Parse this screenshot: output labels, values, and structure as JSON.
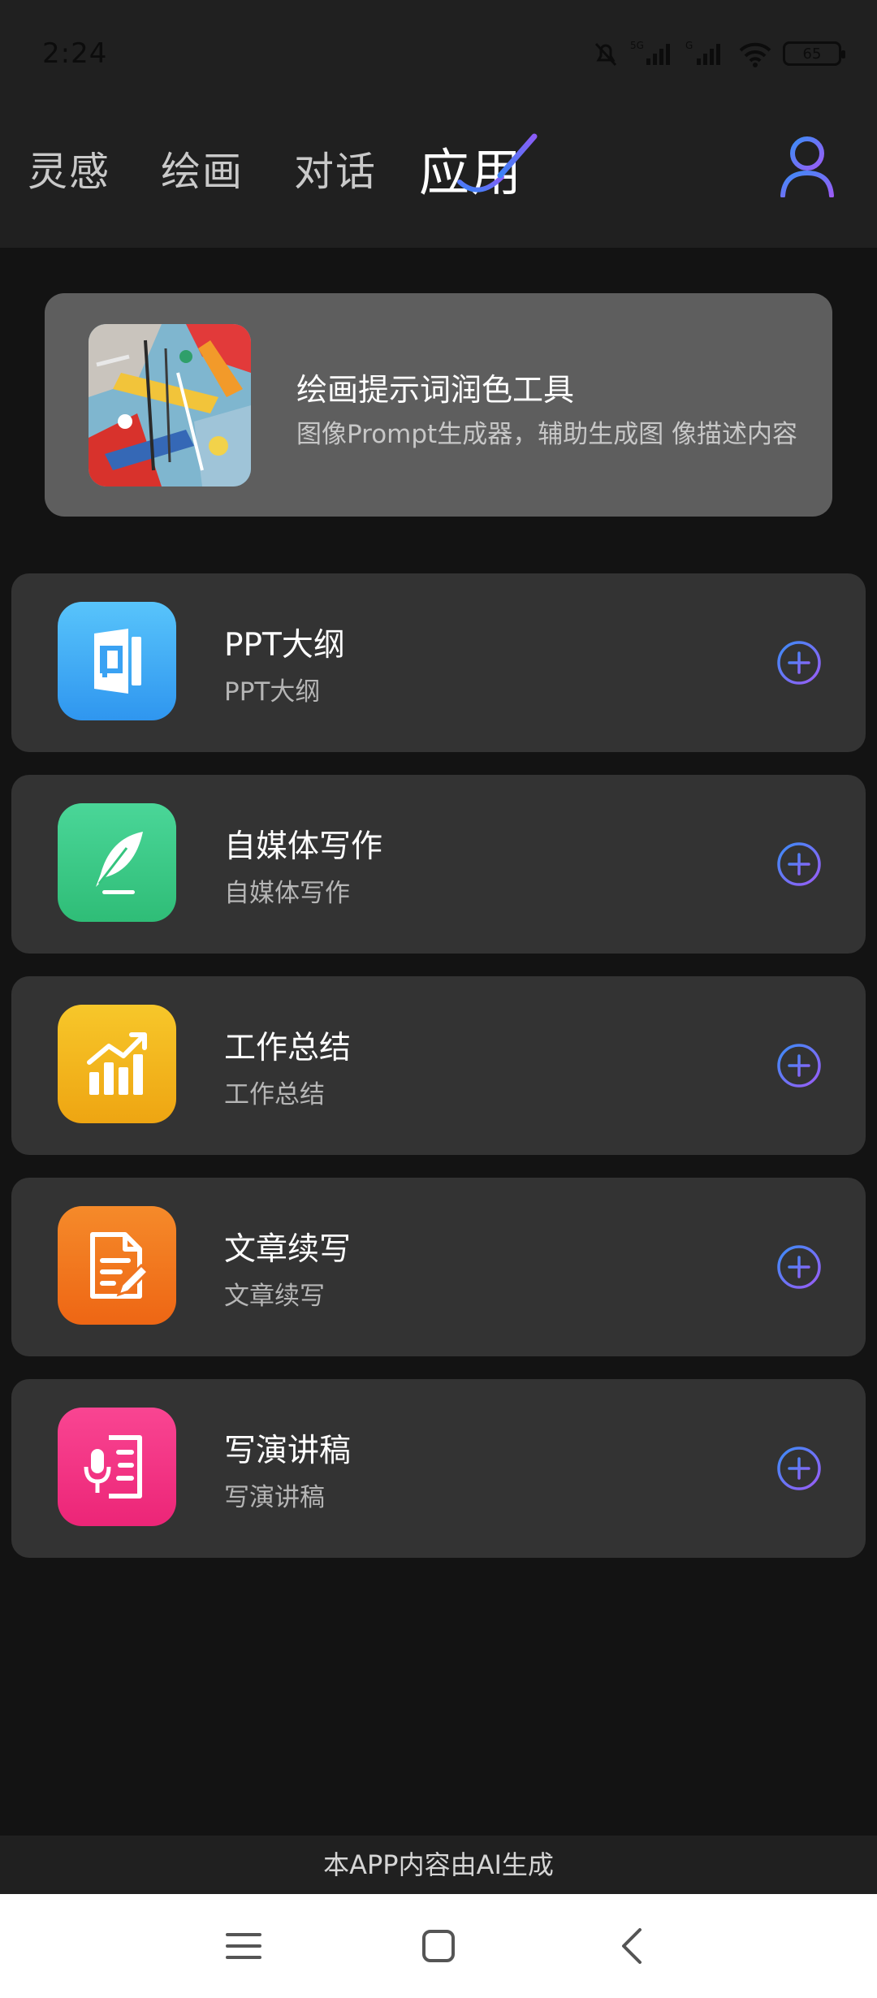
{
  "status_bar": {
    "time": "2:24",
    "battery": "65",
    "network_1": "5G",
    "network_2": "G"
  },
  "header": {
    "tabs": [
      {
        "label": "灵感"
      },
      {
        "label": "绘画"
      },
      {
        "label": "对话"
      },
      {
        "label": "应用",
        "active": true
      }
    ]
  },
  "feature": {
    "title": "绘画提示词润色工具",
    "subtitle": "图像Prompt生成器，辅助生成图 像描述内容"
  },
  "apps": [
    {
      "title": "PPT大纲",
      "subtitle": "PPT大纲",
      "icon": "ppt-icon",
      "color": "#3fa9f5"
    },
    {
      "title": "自媒体写作",
      "subtitle": "自媒体写作",
      "icon": "feather-icon",
      "color": "#3ec985"
    },
    {
      "title": "工作总结",
      "subtitle": "工作总结",
      "icon": "chart-icon",
      "color": "#f2b51d"
    },
    {
      "title": "文章续写",
      "subtitle": "文章续写",
      "icon": "document-edit-icon",
      "color": "#f1711f"
    },
    {
      "title": "写演讲稿",
      "subtitle": "写演讲稿",
      "icon": "microphone-icon",
      "color": "#f23685"
    }
  ],
  "footer_note": "本APP内容由AI生成",
  "colors": {
    "accent_blue": "#4a7cff",
    "accent_purple": "#8b5cf6",
    "background": "#131313",
    "card": "#333333"
  }
}
